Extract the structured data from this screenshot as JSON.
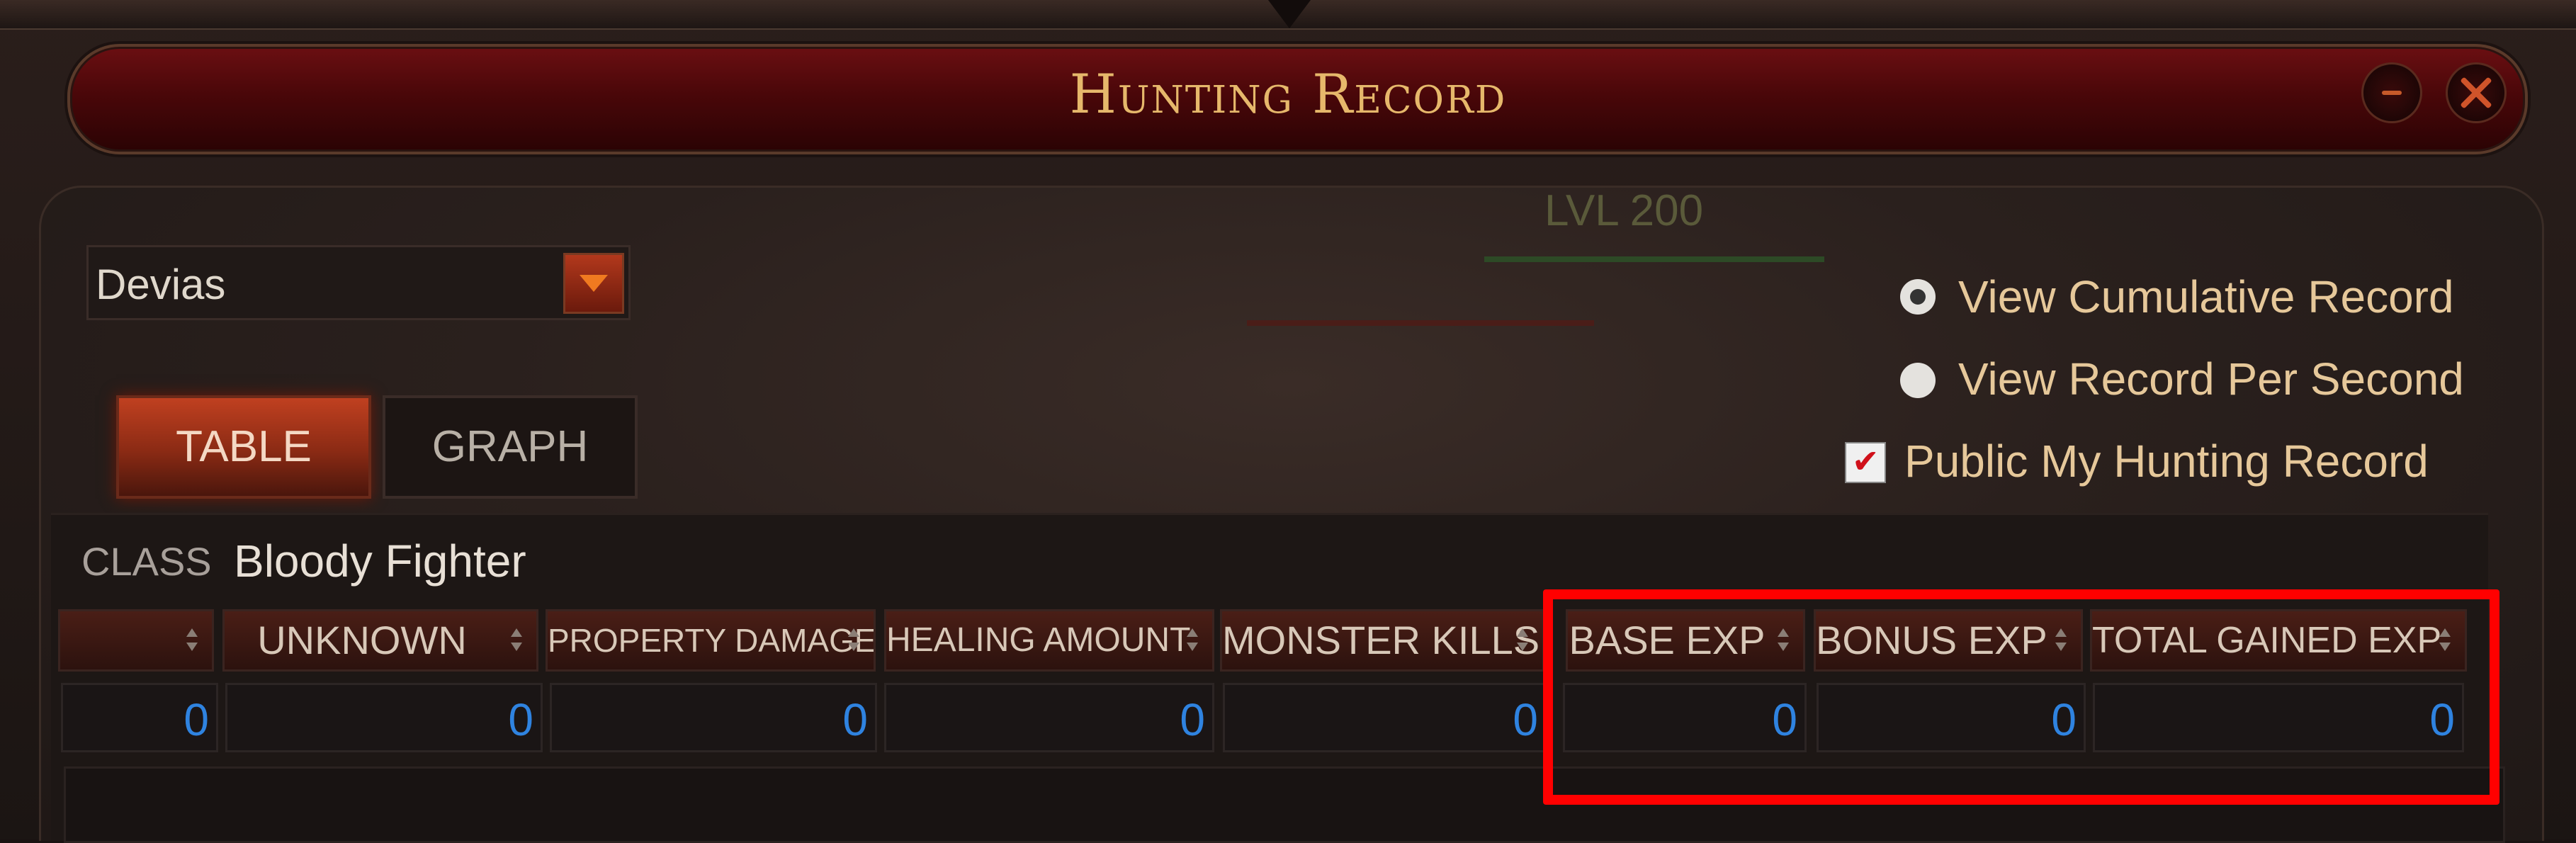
{
  "window": {
    "title": "Hunting Record"
  },
  "background": {
    "level_text": "LVL 200"
  },
  "map_select": {
    "value": "Devias"
  },
  "tabs": [
    {
      "label": "TABLE",
      "active": true
    },
    {
      "label": "GRAPH",
      "active": false
    }
  ],
  "options": {
    "view_cumulative": {
      "label": "View Cumulative Record",
      "selected": true
    },
    "view_per_second": {
      "label": "View Record Per Second",
      "selected": false
    },
    "public_record": {
      "label": "Public  My Hunting Record",
      "checked": true
    }
  },
  "class_row": {
    "label": "CLASS",
    "value": "Bloody Fighter"
  },
  "table": {
    "columns": [
      {
        "label": ""
      },
      {
        "label": "UNKNOWN"
      },
      {
        "label": "PROPERTY DAMAGE"
      },
      {
        "label": "HEALING AMOUNT"
      },
      {
        "label": "MONSTER KILLS"
      },
      {
        "label": "BASE EXP"
      },
      {
        "label": "BONUS EXP"
      },
      {
        "label": "TOTAL GAINED EXP"
      }
    ],
    "values": [
      "0",
      "0",
      "0",
      "0",
      "0",
      "0",
      "0",
      "0"
    ]
  },
  "colors": {
    "accent_title": "#e6b86b",
    "value_blue": "#2f83e0",
    "highlight": "#ff0000"
  }
}
